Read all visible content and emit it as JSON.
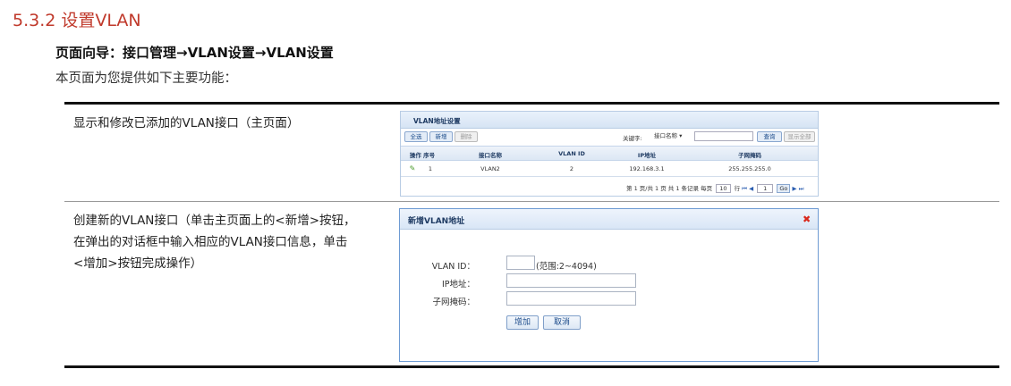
{
  "doc": {
    "section_heading": "5.3.2 设置VLAN",
    "nav_path": "页面向导：接口管理→VLAN设置→VLAN设置",
    "intro": "本页面为您提供如下主要功能：",
    "rows": [
      {
        "desc_lines": [
          "显示和修改已添加的VLAN接口（主页面）"
        ]
      },
      {
        "desc_lines": [
          "创建新的VLAN接口（单击主页面上的<新增>按钮，",
          "在弹出的对话框中输入相应的VLAN接口信息，单击",
          "<增加>按钮完成操作）"
        ]
      }
    ]
  },
  "list_panel": {
    "title": "VLAN地址设置",
    "buttons": {
      "select_all": "全选",
      "add": "新增",
      "delete": "删除"
    },
    "search": {
      "label": "关键字:",
      "field": "接口名称 ▾",
      "query_btn": "查询",
      "show_all_btn": "显示全部"
    },
    "headers": {
      "op_seq": "操作 序号",
      "name": "接口名称",
      "vlan_id": "VLAN ID",
      "ip": "IP地址",
      "mask": "子网掩码"
    },
    "rows": [
      {
        "seq": "1",
        "name": "VLAN2",
        "vlan_id": "2",
        "ip": "192.168.3.1",
        "mask": "255.255.255.0"
      }
    ],
    "pager": {
      "text": "第 1 页/共 1 页 共 1 条记录 每页",
      "per_page": "10",
      "rows_unit": "行",
      "page": "1",
      "go": "Go"
    }
  },
  "dialog": {
    "title": "新增VLAN地址",
    "vlan_id_label": "VLAN ID：",
    "vlan_id_range": "(范围:2~4094)",
    "ip_label": "IP地址：",
    "mask_label": "子网掩码：",
    "add_btn": "增加",
    "cancel_btn": "取消"
  },
  "colors": {
    "heading": "#c0392b",
    "panel_border": "#b8cce4",
    "close": "#d9291c"
  }
}
